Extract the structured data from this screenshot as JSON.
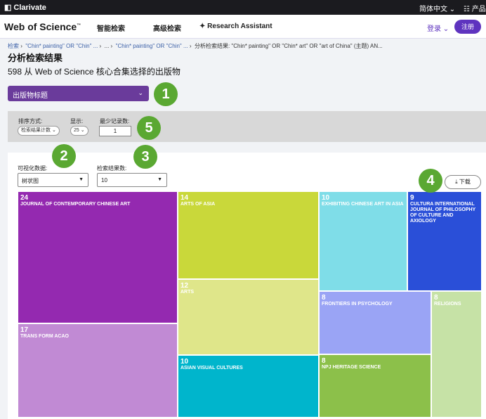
{
  "topbar": {
    "brand": "Clarivate",
    "language": "简体中文",
    "products": "产品"
  },
  "navbar": {
    "logo": "Web of Science",
    "logo_tm": "™",
    "items": [
      "智能检索",
      "高级检索",
      "Research Assistant"
    ],
    "login": "登录",
    "register": "注册"
  },
  "breadcrumb": {
    "items": [
      "检索",
      "\"Chin* painting\" OR \"Chin\" ...",
      "...",
      "\"Chin* painting\" OR \"Chin\" ...",
      "分析检索结果: \"Chin* painting\" OR \"Chin* art\" OR \"art of China\" (主题) AN..."
    ]
  },
  "page": {
    "title": "分析检索结果",
    "subtitle": "598 从 Web of Science 核心合集选择的出版物",
    "field_dropdown": "出版物标题"
  },
  "controls": {
    "sort_label": "排序方式:",
    "sort_value": "检索结果计数",
    "show_label": "显示:",
    "show_value": "25",
    "min_label": "最少记录数:",
    "min_value": "1"
  },
  "visual": {
    "viz_label": "可视化数据:",
    "viz_value": "树状图",
    "count_label": "检索结果数:",
    "count_value": "10",
    "download": "下载"
  },
  "badges": [
    "1",
    "2",
    "3",
    "4",
    "5"
  ],
  "treemap": [
    {
      "count": "24",
      "name": "JOURNAL OF CONTEMPORARY CHINESE ART",
      "color": "#9429b0"
    },
    {
      "count": "17",
      "name": "TRANS FORM ACAO",
      "color": "#c18ad4"
    },
    {
      "count": "14",
      "name": "ARTS OF ASIA",
      "color": "#c9d83a"
    },
    {
      "count": "12",
      "name": "ARTS",
      "color": "#dfe68a"
    },
    {
      "count": "10",
      "name": "ASIAN VISUAL CULTURES",
      "color": "#00b5cc"
    },
    {
      "count": "10",
      "name": "EXHIBITING CHINESE ART IN ASIA",
      "color": "#7fdde8"
    },
    {
      "count": "9",
      "name": "CULTURA INTERNATIONAL JOURNAL OF PHILOSOPHY OF CULTURE AND AXIOLOGY",
      "color": "#2a4fd8"
    },
    {
      "count": "8",
      "name": "FRONTIERS IN PSYCHOLOGY",
      "color": "#9aa4f5"
    },
    {
      "count": "8",
      "name": "NPJ HERITAGE SCIENCE",
      "color": "#8cc04a"
    },
    {
      "count": "8",
      "name": "RELIGIONS",
      "color": "#c6e2a6"
    }
  ]
}
